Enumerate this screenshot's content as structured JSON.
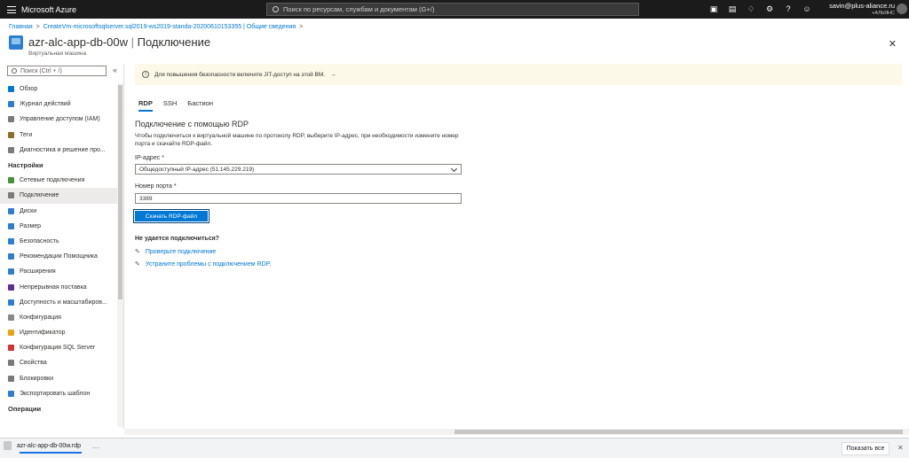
{
  "topbar": {
    "brand": "Microsoft Azure",
    "search_placeholder": "Поиск по ресурсам, службам и документам (G+/)",
    "account_email": "savin@plus-aliance.ru",
    "account_org": "+АЛЬЯНС"
  },
  "breadcrumb": {
    "items": [
      "Главная",
      "CreateVm-microsoftsqlserver.sql2019-ws2019-standa-20200610153355 | Общие сведения"
    ]
  },
  "header": {
    "title_name": "azr-alc-app-db-00w",
    "title_section": "Подключение",
    "subtitle": "Виртуальная машина"
  },
  "sidebar": {
    "search_placeholder": "Поиск (Ctrl + /)",
    "items": [
      {
        "label": "Обзор",
        "color": "#0078d4"
      },
      {
        "label": "Журнал действий",
        "color": "#2f7dd1"
      },
      {
        "label": "Управление доступом (IAM)",
        "color": "#7a7a7a"
      },
      {
        "label": "Теги",
        "color": "#8a6f2d"
      },
      {
        "label": "Диагностика и решение про...",
        "color": "#7a7a7a"
      }
    ],
    "group_settings": "Настройки",
    "settings_items": [
      {
        "label": "Сетевые подключения",
        "color": "#4a8f3c"
      },
      {
        "label": "Подключение",
        "color": "#7a7a7a"
      },
      {
        "label": "Диски",
        "color": "#2f7dd1"
      },
      {
        "label": "Размер",
        "color": "#2f7dd1"
      },
      {
        "label": "Безопасность",
        "color": "#2f7dd1"
      },
      {
        "label": "Рекомендации Помощника",
        "color": "#2f7dd1"
      },
      {
        "label": "Расширения",
        "color": "#2f7dd1"
      },
      {
        "label": "Непрерывная поставка",
        "color": "#5c2d91"
      },
      {
        "label": "Доступность и масштабиров...",
        "color": "#2f7dd1"
      },
      {
        "label": "Конфигурация",
        "color": "#8a8886"
      },
      {
        "label": "Идентификатор",
        "color": "#e8a317"
      },
      {
        "label": "Конфигурация SQL Server",
        "color": "#d13438"
      },
      {
        "label": "Свойства",
        "color": "#7a7a7a"
      },
      {
        "label": "Блокировки",
        "color": "#7a7a7a"
      },
      {
        "label": "Экспортировать шаблон",
        "color": "#2f7dd1"
      }
    ],
    "group_operations": "Операции"
  },
  "banner": {
    "text": "Для повышения безопасности включите JIT-доступ на этой ВМ."
  },
  "tabs": [
    "RDP",
    "SSH",
    "Бастион"
  ],
  "main": {
    "section_title": "Подключение с помощью RDP",
    "description": "Чтобы подключиться к виртуальной машине по протоколу RDP, выберите IP-адрес, при необходимости измените номер порта и скачайте RDP-файл.",
    "ip_label": "IP-адрес *",
    "ip_value": "Общедоступный IP-адрес (51.145.229.219)",
    "port_label": "Номер порта *",
    "port_value": "3389",
    "download_button": "Скачать RDP-файл",
    "help_title": "Не удается подключиться?",
    "help_links": [
      "Проверьте подключение",
      "Устраните проблемы с подключением RDP."
    ]
  },
  "download_bar": {
    "file_name": "azr-alc-app-db-00w.rdp",
    "show_all": "Показать все"
  }
}
